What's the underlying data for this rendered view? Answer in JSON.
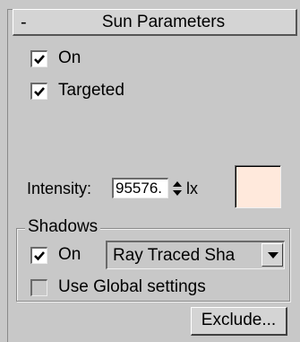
{
  "rollout": {
    "toggle_symbol": "-",
    "title": "Sun Parameters"
  },
  "checkboxes": {
    "on": {
      "label": "On",
      "checked": true
    },
    "targeted": {
      "label": "Targeted",
      "checked": true
    }
  },
  "intensity": {
    "label": "Intensity:",
    "value": "95576.",
    "unit": "lx",
    "color": "#ffe9dc"
  },
  "shadows": {
    "group_title": "Shadows",
    "on": {
      "label": "On",
      "checked": true
    },
    "type_selected": "Ray Traced Sha",
    "use_global": {
      "label": "Use Global settings",
      "checked": false
    }
  },
  "buttons": {
    "exclude_label": "Exclude..."
  },
  "colors": {
    "panel_bg": "#c8c8c8",
    "swatch": "#ffe9dc"
  }
}
